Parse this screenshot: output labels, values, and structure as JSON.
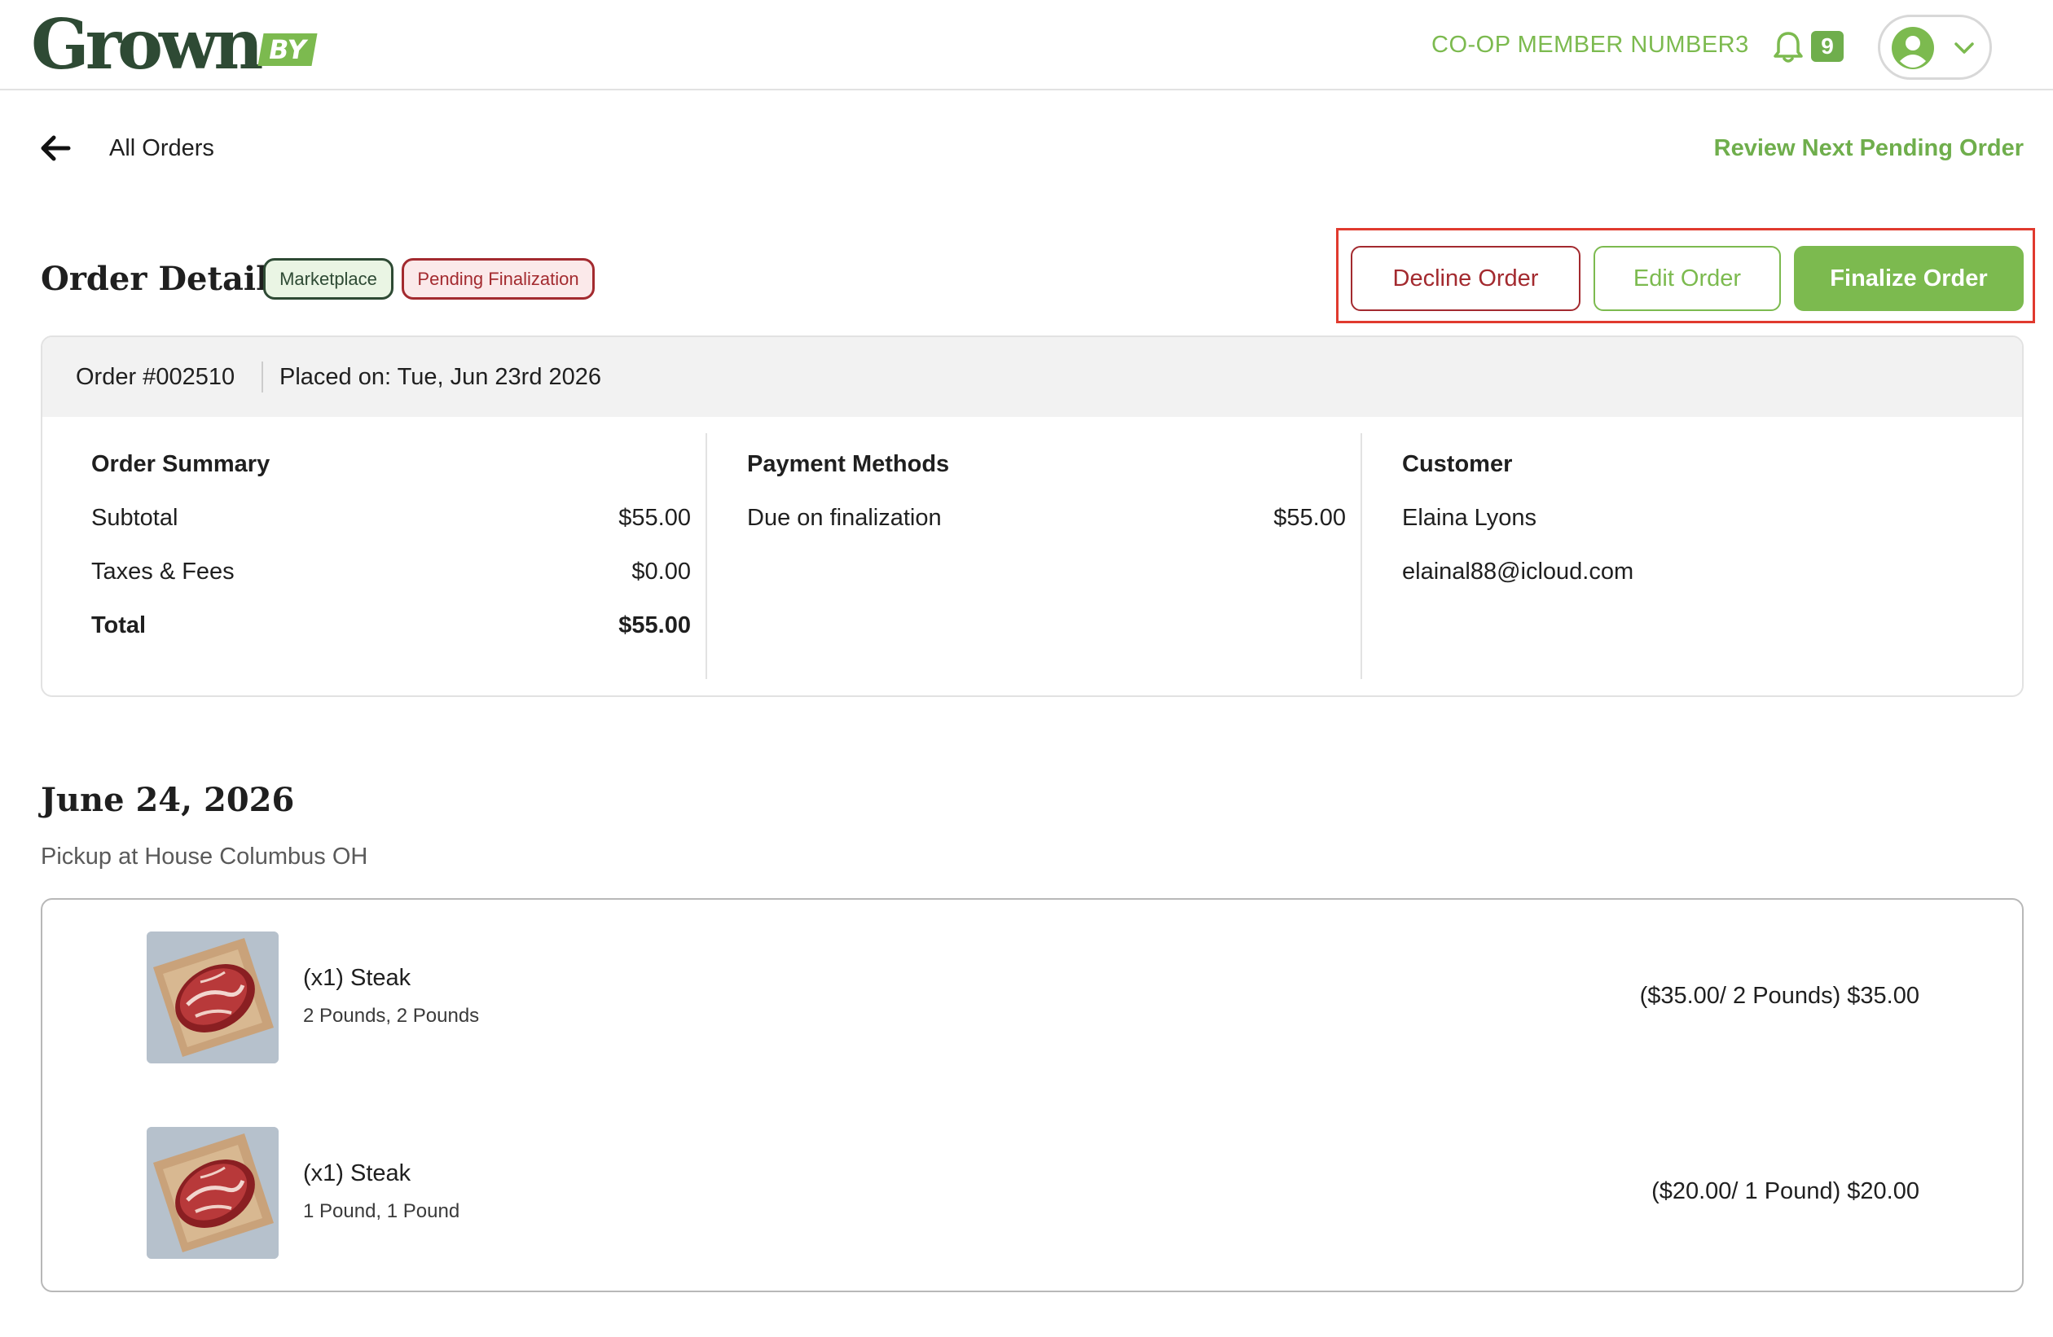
{
  "header": {
    "logo": {
      "word": "Grown",
      "badge": "BY"
    },
    "member_name": "CO-OP MEMBER NUMBER3",
    "notification_count": "9",
    "icons": {
      "bell": "bell-icon",
      "avatar": "user-avatar-icon",
      "menu": "chevron-down-icon"
    }
  },
  "subnav": {
    "back_label": "All Orders",
    "review_next_label": "Review Next Pending Order"
  },
  "title_row": {
    "title": "Order Details",
    "tags": {
      "marketplace": "Marketplace",
      "status": "Pending Finalization"
    },
    "actions": {
      "decline": "Decline Order",
      "edit": "Edit Order",
      "finalize": "Finalize Order"
    }
  },
  "order": {
    "number": "Order #002510",
    "placed_on": "Placed on: Tue, Jun 23rd 2026",
    "summary": {
      "heading": "Order Summary",
      "subtotal_label": "Subtotal",
      "subtotal": "$55.00",
      "taxes_label": "Taxes & Fees",
      "taxes": "$0.00",
      "total_label": "Total",
      "total": "$55.00"
    },
    "payment": {
      "heading": "Payment Methods",
      "method_label": "Due on finalization",
      "method_amount": "$55.00"
    },
    "customer": {
      "heading": "Customer",
      "name": "Elaina Lyons",
      "email": "elainal88@icloud.com"
    }
  },
  "pickup": {
    "date": "June 24, 2026",
    "location": "Pickup at House Columbus OH",
    "items": [
      {
        "title": "(x1) Steak",
        "options": "2 Pounds, 2 Pounds",
        "price": "($35.00/ 2 Pounds)  $35.00"
      },
      {
        "title": "(x1) Steak",
        "options": "1 Pound, 1 Pound",
        "price": "($20.00/ 1 Pound)  $20.00"
      }
    ]
  },
  "colors": {
    "brand_dark": "#2e4a34",
    "brand_green": "#7cba4f",
    "danger": "#a32a2f",
    "highlight_box": "#e03a2e"
  }
}
